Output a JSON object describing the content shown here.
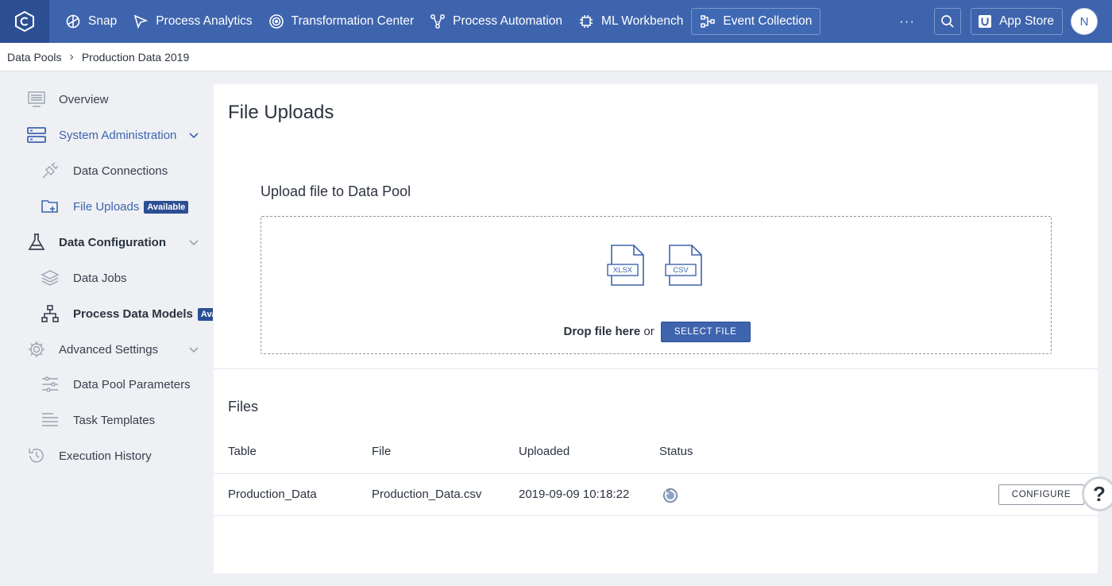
{
  "topnav": {
    "items": [
      {
        "label": "Snap",
        "icon": "snap-icon"
      },
      {
        "label": "Process Analytics",
        "icon": "process-analytics-icon"
      },
      {
        "label": "Transformation Center",
        "icon": "target-icon"
      },
      {
        "label": "Process Automation",
        "icon": "automation-icon"
      },
      {
        "label": "ML Workbench",
        "icon": "chip-icon"
      },
      {
        "label": "Event Collection",
        "icon": "event-collection-icon"
      }
    ],
    "more": "···",
    "app_store": "App Store",
    "avatar_initial": "N"
  },
  "breadcrumb": {
    "root": "Data Pools",
    "separator": "›",
    "current": "Production Data 2019"
  },
  "sidebar": {
    "items": [
      {
        "label": "Overview"
      },
      {
        "label": "System Administration"
      },
      {
        "label": "Data Connections"
      },
      {
        "label": "File Uploads",
        "badge": "Available"
      },
      {
        "label": "Data Configuration"
      },
      {
        "label": "Data Jobs"
      },
      {
        "label": "Process Data Models",
        "badge": "Available"
      },
      {
        "label": "Advanced Settings"
      },
      {
        "label": "Data Pool Parameters"
      },
      {
        "label": "Task Templates"
      },
      {
        "label": "Execution History"
      }
    ]
  },
  "main": {
    "title": "File Uploads",
    "upload_title": "Upload file to Data Pool",
    "file_types": [
      "XLSX",
      "CSV"
    ],
    "drop_text": "Drop file here",
    "or_text": "or",
    "select_button": "SELECT FILE",
    "files_title": "Files",
    "columns": [
      "Table",
      "File",
      "Uploaded",
      "Status"
    ],
    "rows": [
      {
        "table": "Production_Data",
        "file": "Production_Data.csv",
        "uploaded": "2019-09-09 10:18:22",
        "action": "CONFIGURE"
      }
    ],
    "help_label": "?"
  },
  "colors": {
    "brand": "#3e64ad",
    "brand_dark": "#2c4f93",
    "background": "#eef0f4"
  }
}
